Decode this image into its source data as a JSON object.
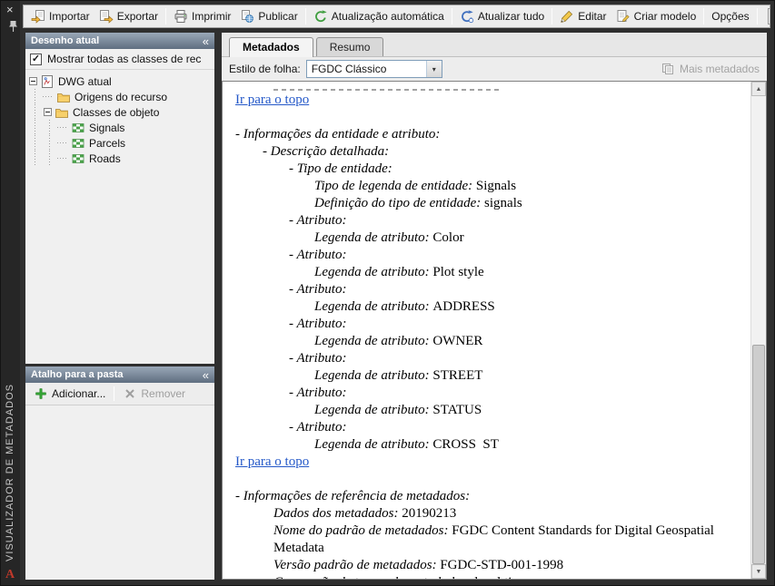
{
  "window": {
    "side_title": "VISUALIZADOR DE METADADOS",
    "logo": "A"
  },
  "glyphs": {
    "close": "×",
    "check": "✓",
    "collapse": "«",
    "combo_arrow": "▾",
    "scroll_up": "▲",
    "scroll_down": "▼",
    "overflow": "▾"
  },
  "toolbar": {
    "groups": [
      [
        {
          "id": "importar",
          "label": "Importar",
          "icon": "import-icon"
        },
        {
          "id": "exportar",
          "label": "Exportar",
          "icon": "export-icon"
        }
      ],
      [
        {
          "id": "imprimir",
          "label": "Imprimir",
          "icon": "print-icon"
        },
        {
          "id": "publicar",
          "label": "Publicar",
          "icon": "publish-icon"
        }
      ],
      [
        {
          "id": "atualizacao-automatica",
          "label": "Atualização automática",
          "icon": "auto-update-icon"
        }
      ],
      [
        {
          "id": "atualizar-tudo",
          "label": "Atualizar tudo",
          "icon": "refresh-all-icon"
        }
      ],
      [
        {
          "id": "editar",
          "label": "Editar",
          "icon": "edit-icon"
        },
        {
          "id": "criar-modelo",
          "label": "Criar modelo",
          "icon": "create-template-icon"
        }
      ],
      [
        {
          "id": "opcoes",
          "label": "Opções",
          "icon": null
        }
      ],
      [
        {
          "id": "ajuda",
          "label": "?",
          "icon": null,
          "square": true
        }
      ]
    ]
  },
  "panels": {
    "drawing": {
      "title": "Desenho atual",
      "checkbox_label": "Mostrar todas as classes de rec",
      "checked": true,
      "tree": [
        {
          "label": "DWG atual",
          "icon": "dwg-icon",
          "level": 0,
          "expander": true
        },
        {
          "label": "Origens do recurso",
          "icon": "folder-icon",
          "level": 1,
          "expander": false
        },
        {
          "label": "Classes de objeto",
          "icon": "folder-icon",
          "level": 1,
          "expander": true
        },
        {
          "label": "Signals",
          "icon": "feature-class-icon",
          "level": 2,
          "expander": false
        },
        {
          "label": "Parcels",
          "icon": "feature-class-icon",
          "level": 2,
          "expander": false
        },
        {
          "label": "Roads",
          "icon": "feature-class-icon",
          "level": 2,
          "expander": false
        }
      ]
    },
    "shortcut": {
      "title": "Atalho para a pasta",
      "add_label": "Adicionar...",
      "remove_label": "Remover"
    }
  },
  "main": {
    "tabs": [
      {
        "label": "Metadados",
        "active": true
      },
      {
        "label": "Resumo",
        "active": false
      }
    ],
    "style_row": {
      "label": "Estilo de folha:",
      "value": "FGDC Clássico",
      "more_label": "Mais metadados"
    },
    "content": {
      "lines": [
        {
          "t": "partial"
        },
        {
          "t": "link",
          "text": "Ir para o topo"
        },
        {
          "t": "blank"
        },
        {
          "t": "label",
          "ind": 0,
          "label": "- Informações da entidade e atributo:"
        },
        {
          "t": "label",
          "ind": 30,
          "label": "- Descrição detalhada:"
        },
        {
          "t": "label",
          "ind": 59,
          "label": "- Tipo de entidade:"
        },
        {
          "t": "pair",
          "ind": 87,
          "label": "Tipo de legenda de entidade:",
          "value": "Signals"
        },
        {
          "t": "pair",
          "ind": 87,
          "label": "Definição do tipo de entidade:",
          "value": "signals"
        },
        {
          "t": "label",
          "ind": 59,
          "label": "- Atributo:"
        },
        {
          "t": "pair",
          "ind": 87,
          "label": "Legenda de atributo:",
          "value": "Color"
        },
        {
          "t": "label",
          "ind": 59,
          "label": "- Atributo:"
        },
        {
          "t": "pair",
          "ind": 87,
          "label": "Legenda de atributo:",
          "value": "Plot style"
        },
        {
          "t": "label",
          "ind": 59,
          "label": "- Atributo:"
        },
        {
          "t": "pair",
          "ind": 87,
          "label": "Legenda de atributo:",
          "value": "ADDRESS"
        },
        {
          "t": "label",
          "ind": 59,
          "label": "- Atributo:"
        },
        {
          "t": "pair",
          "ind": 87,
          "label": "Legenda de atributo:",
          "value": "OWNER"
        },
        {
          "t": "label",
          "ind": 59,
          "label": "- Atributo:"
        },
        {
          "t": "pair",
          "ind": 87,
          "label": "Legenda de atributo:",
          "value": "STREET"
        },
        {
          "t": "label",
          "ind": 59,
          "label": "- Atributo:"
        },
        {
          "t": "pair",
          "ind": 87,
          "label": "Legenda de atributo:",
          "value": "STATUS"
        },
        {
          "t": "label",
          "ind": 59,
          "label": "- Atributo:"
        },
        {
          "t": "pair",
          "ind": 87,
          "label": "Legenda de atributo:",
          "value": "CROSS  ST"
        },
        {
          "t": "link",
          "text": "Ir para o topo"
        },
        {
          "t": "blank"
        },
        {
          "t": "label",
          "ind": 0,
          "label": "- Informações de referência de metadados:"
        },
        {
          "t": "pair",
          "ind": 42,
          "label": "Dados dos metadados:",
          "value": "20190213"
        },
        {
          "t": "pair",
          "ind": 42,
          "label": "Nome do padrão de metadados:",
          "value": "FGDC Content Standards for Digital Geospatial Metadata"
        },
        {
          "t": "pair",
          "ind": 42,
          "label": "Versão padrão de metadados:",
          "value": "FGDC-STD-001-1998"
        },
        {
          "t": "pair",
          "ind": 42,
          "label": "Convenção de tempo de metadados:",
          "value": "local time"
        }
      ]
    }
  }
}
